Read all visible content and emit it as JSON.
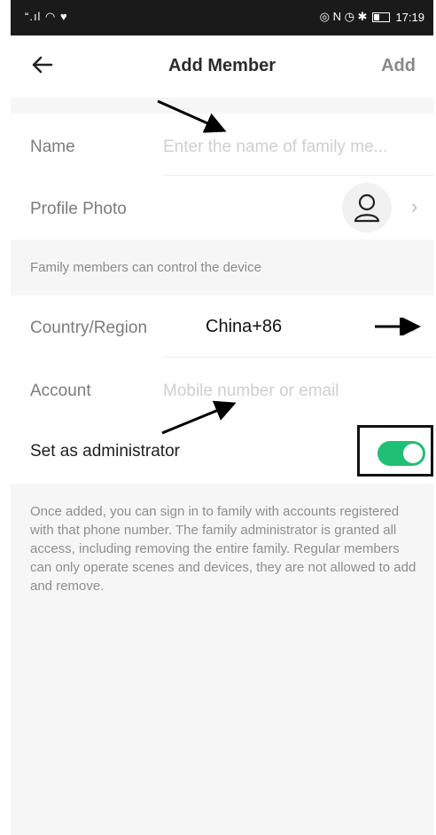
{
  "status_bar": {
    "left": "“ . || ◘ ♥",
    "time": "17:19"
  },
  "header": {
    "title": "Add Member",
    "add_label": "Add"
  },
  "form": {
    "name_label": "Name",
    "name_placeholder": "Enter the name of family me...",
    "photo_label": "Profile Photo",
    "control_note": "Family members can control the device",
    "country_label": "Country/Region",
    "country_value": "China+86",
    "account_label": "Account",
    "account_placeholder": "Mobile number or email",
    "admin_label": "Set as administrator",
    "admin_enabled": true
  },
  "info_text": "Once added, you can sign in to family with accounts registered with that phone number. The family administrator is granted all access, including removing the entire family. Regular members can only operate scenes and devices, they are not allowed to add and remove.",
  "colors": {
    "toggle_on": "#1fbf76",
    "status_bar": "#1a1a1a"
  }
}
